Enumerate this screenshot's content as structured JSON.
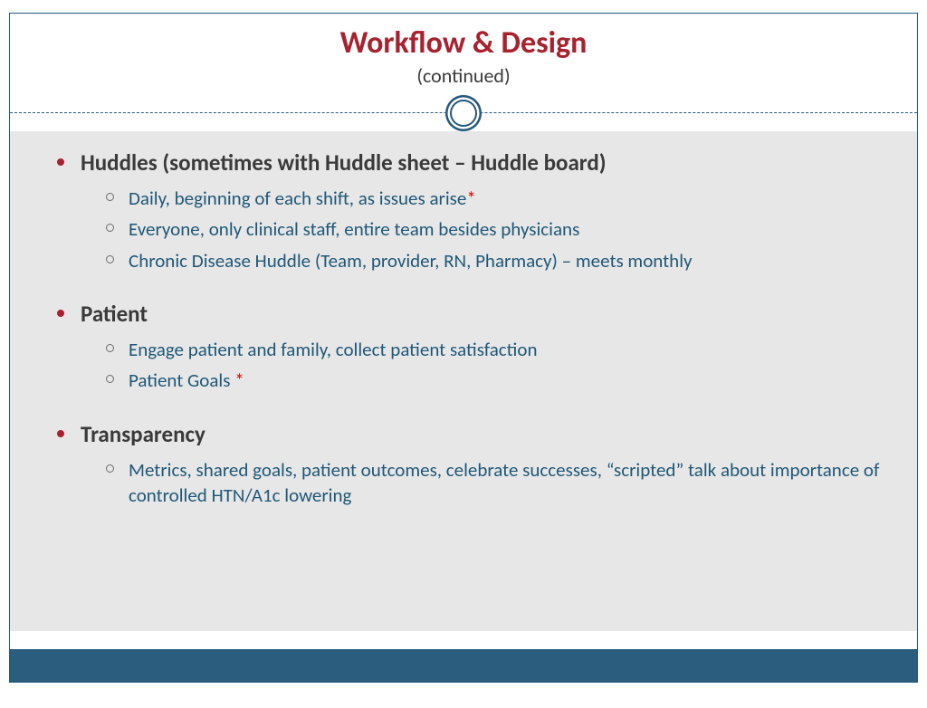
{
  "title": "Workflow & Design",
  "subtitle": "(continued)",
  "sections": [
    {
      "title": "Huddles (sometimes with Huddle sheet – Huddle board)",
      "items": [
        {
          "text": "Daily, beginning of each shift, as issues arise",
          "star": true
        },
        {
          "text": "Everyone, only clinical staff, entire team besides physicians",
          "star": false
        },
        {
          "text": "Chronic Disease Huddle (Team, provider, RN, Pharmacy) – meets monthly",
          "star": false
        }
      ]
    },
    {
      "title": "Patient",
      "items": [
        {
          "text": "Engage patient and family, collect patient satisfaction",
          "star": false
        },
        {
          "text": "Patient Goals ",
          "star": true
        }
      ]
    },
    {
      "title": "Transparency",
      "items": [
        {
          "text": "Metrics, shared goals, patient outcomes, celebrate successes, “scripted” talk about importance of controlled HTN/A1c lowering",
          "star": false
        }
      ]
    }
  ]
}
